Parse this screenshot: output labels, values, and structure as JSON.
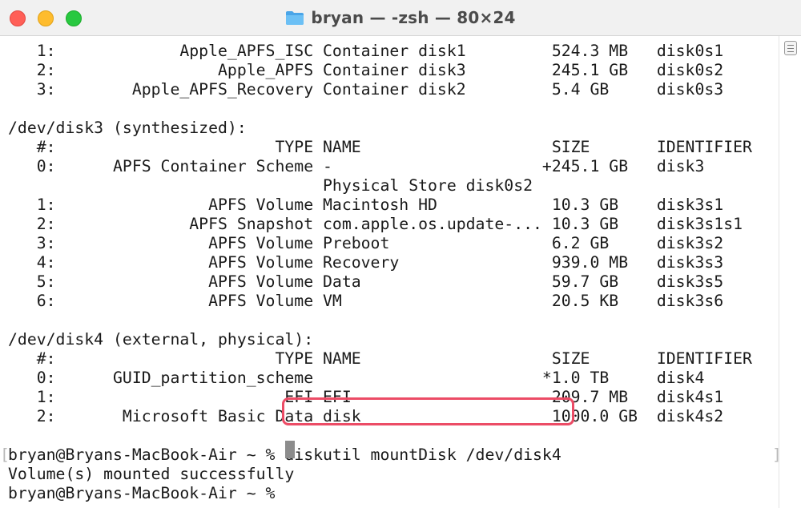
{
  "window": {
    "title": "bryan — -zsh — 80×24",
    "icon": "folder-icon"
  },
  "terminal": {
    "lines": [
      "   1:             Apple_APFS_ISC Container disk1         524.3 MB   disk0s1",
      "   2:                 Apple_APFS Container disk3         245.1 GB   disk0s2",
      "   3:        Apple_APFS_Recovery Container disk2         5.4 GB     disk0s3",
      "",
      "/dev/disk3 (synthesized):",
      "   #:                       TYPE NAME                    SIZE       IDENTIFIER",
      "   0:      APFS Container Scheme -                      +245.1 GB   disk3",
      "                                 Physical Store disk0s2",
      "   1:                APFS Volume Macintosh HD            10.3 GB    disk3s1",
      "   2:              APFS Snapshot com.apple.os.update-... 10.3 GB    disk3s1s1",
      "   3:                APFS Volume Preboot                 6.2 GB     disk3s2",
      "   4:                APFS Volume Recovery                939.0 MB   disk3s3",
      "   5:                APFS Volume Data                    59.7 GB    disk3s5",
      "   6:                APFS Volume VM                      20.5 KB    disk3s6",
      "",
      "/dev/disk4 (external, physical):",
      "   #:                       TYPE NAME                    SIZE       IDENTIFIER",
      "   0:      GUID_partition_scheme                        *1.0 TB     disk4",
      "   1:                        EFI EFI                     209.7 MB   disk4s1",
      "   2:       Microsoft Basic Data disk                    1000.0 GB  disk4s2",
      ""
    ],
    "command_prompt": "bryan@Bryans-MacBook-Air ~ % ",
    "command": "diskutil mountDisk /dev/disk4",
    "result": "Volume(s) mounted successfully",
    "current_prompt": "bryan@Bryans-MacBook-Air ~ % ",
    "left_bracket": "[",
    "right_bracket": "]"
  },
  "colors": {
    "highlight_border": "#ec4c66",
    "cursor": "#8c8c8c",
    "text": "#1a1a1a"
  }
}
